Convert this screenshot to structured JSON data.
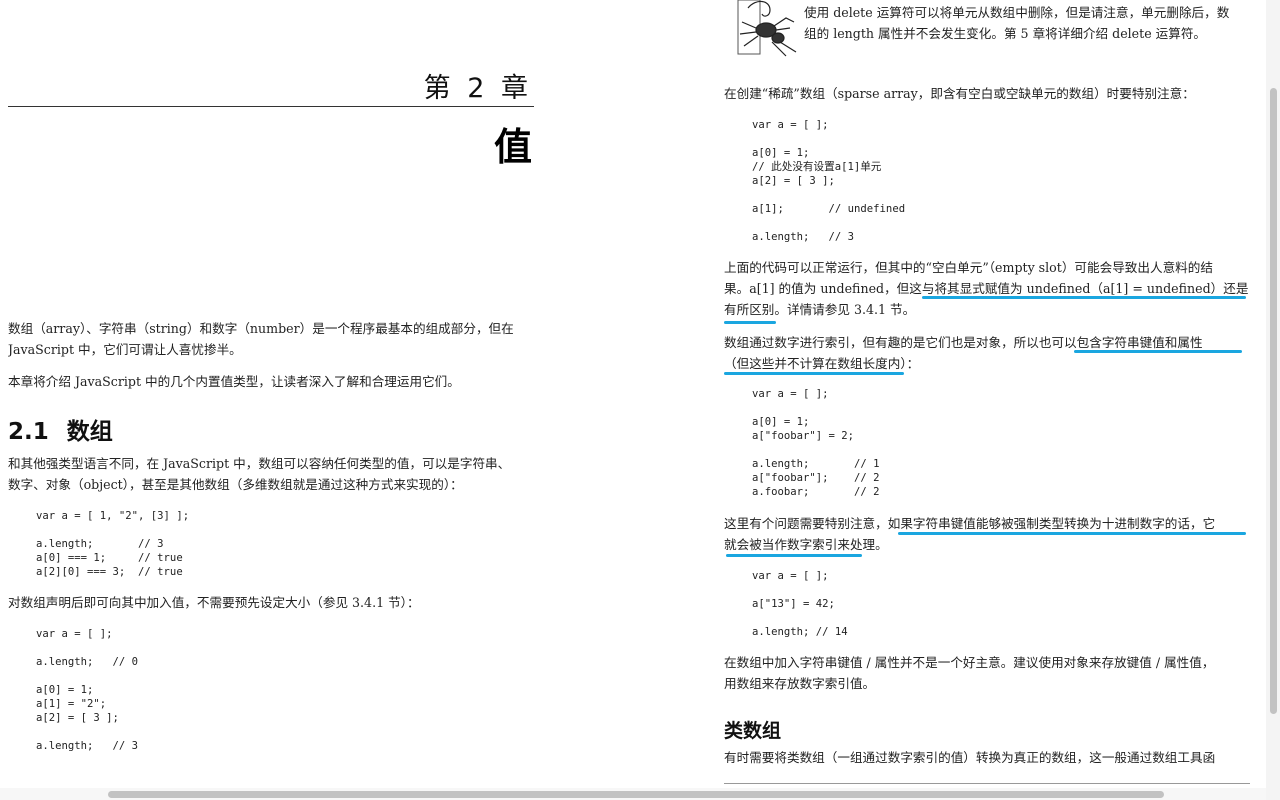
{
  "left_page": {
    "chapter_label": "第 2 章",
    "chapter_title": "值",
    "intro": [
      "数组（array）、字符串（string）和数字（number）是一个程序最基本的组成部分，但在",
      "JavaScript 中，它们可谓让人喜忧掺半。"
    ],
    "intro2": "本章将介绍 JavaScript 中的几个内置值类型，让读者深入了解和合理运用它们。",
    "section_number": "2.1",
    "section_title": "数组",
    "section_para": [
      "和其他强类型语言不同，在 JavaScript 中，数组可以容纳任何类型的值，可以是字符串、",
      "数字、对象（object），甚至是其他数组（多维数组就是通过这种方式来实现的）："
    ],
    "code1": "var a = [ 1, \"2\", [3] ];\n\na.length;       // 3\na[0] === 1;     // true\na[2][0] === 3;  // true",
    "para_after_code1": "对数组声明后即可向其中加入值，不需要预先设定大小（参见 3.4.1 节）：",
    "code2": "var a = [ ];\n\na.length;   // 0\n\na[0] = 1;\na[1] = \"2\";\na[2] = [ 3 ];\n\na.length;   // 3"
  },
  "right_page": {
    "note": [
      "使用 delete 运算符可以将单元从数组中删除，但是请注意，单元删除后，数",
      "组的 length 属性并不会发生变化。第 5 章将详细介绍 delete 运算符。"
    ],
    "sparse_intro": "在创建“稀疏”数组（sparse array，即含有空白或空缺单元的数组）时要特别注意：",
    "code3": "var a = [ ];\n\na[0] = 1;\n// 此处没有设置a[1]单元\na[2] = [ 3 ];\n\na[1];       // undefined\n\na.length;   // 3",
    "sparse_para": [
      "上面的代码可以正常运行，但其中的“空白单元”（empty slot）可能会导致出人意料的结",
      "果。a[1] 的值为 undefined，但这与将其显式赋值为 undefined（a[1] = undefined）还是",
      "有所区别。详情请参见 3.4.1 节。"
    ],
    "index_para": [
      "数组通过数字进行索引，但有趣的是它们也是对象，所以也可以包含字符串键值和属性",
      "（但这些并不计算在数组长度内）："
    ],
    "code4": "var a = [ ];\n\na[0] = 1;\na[\"foobar\"] = 2;\n\na.length;       // 1\na[\"foobar\"];    // 2\na.foobar;       // 2",
    "caution_para": [
      "这里有个问题需要特别注意，如果字符串键值能够被强制类型转换为十进制数字的话，它",
      "就会被当作数字索引来处理。"
    ],
    "code5": "var a = [ ];\n\na[\"13\"] = 42;\n\na.length; // 14",
    "advice_para": [
      "在数组中加入字符串键值 / 属性并不是一个好主意。建议使用对象来存放键值 / 属性值，",
      "用数组来存放数字索引值。"
    ],
    "subsection_title": "类数组",
    "array_like_para": "有时需要将类数组（一组通过数字索引的值）转换为真正的数组，这一般通过数组工具函"
  },
  "colors": {
    "highlight": "#1aa6e0",
    "text": "#222222"
  },
  "icons": {
    "note_icon": "scorpion-icon"
  }
}
